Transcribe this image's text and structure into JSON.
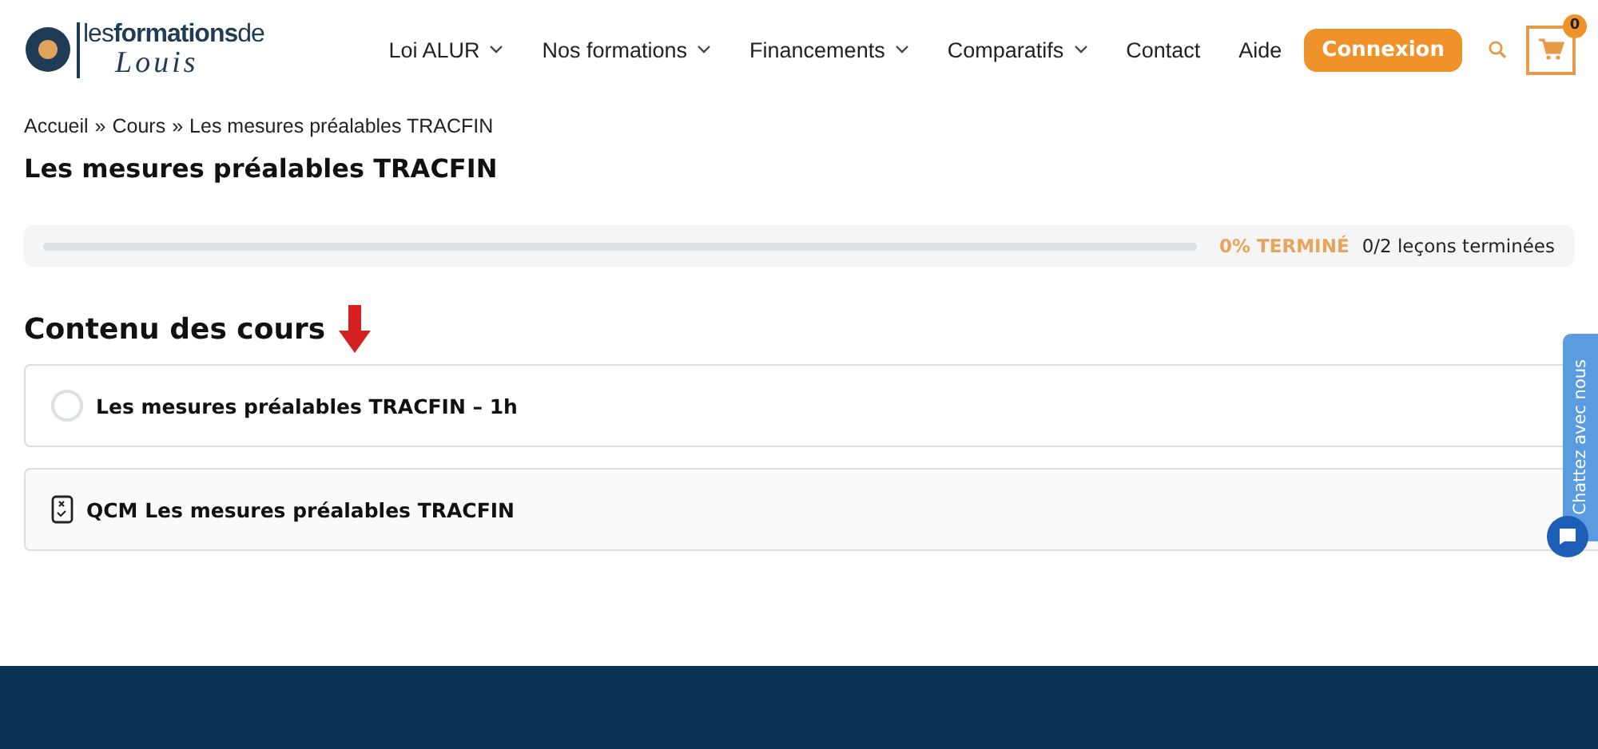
{
  "logo": {
    "line1_light": "les",
    "line1_bold": "formations",
    "line1_end": "de",
    "line2": "Louis"
  },
  "nav": [
    {
      "label": "Loi ALUR",
      "dropdown": true
    },
    {
      "label": "Nos formations",
      "dropdown": true
    },
    {
      "label": "Financements",
      "dropdown": true
    },
    {
      "label": "Comparatifs",
      "dropdown": true
    },
    {
      "label": "Contact",
      "dropdown": false
    },
    {
      "label": "Aide",
      "dropdown": false
    }
  ],
  "login_button": "Connexion",
  "cart_count": "0",
  "breadcrumb": [
    "Accueil",
    "»",
    "Cours",
    "»",
    "Les mesures préalables TRACFIN"
  ],
  "page_title": "Les mesures préalables TRACFIN",
  "progress": {
    "level": 0,
    "percent": "0% TERMINÉ",
    "steps": "0/2 leçons terminées"
  },
  "content_heading": "Contenu des cours",
  "lessons": [
    {
      "kind": "lesson",
      "title": "Les mesures préalables TRACFIN – 1h",
      "completed": false
    },
    {
      "kind": "quiz",
      "title": "QCM Les mesures préalables TRACFIN"
    }
  ],
  "chat_tab": "Chattez avec nous"
}
